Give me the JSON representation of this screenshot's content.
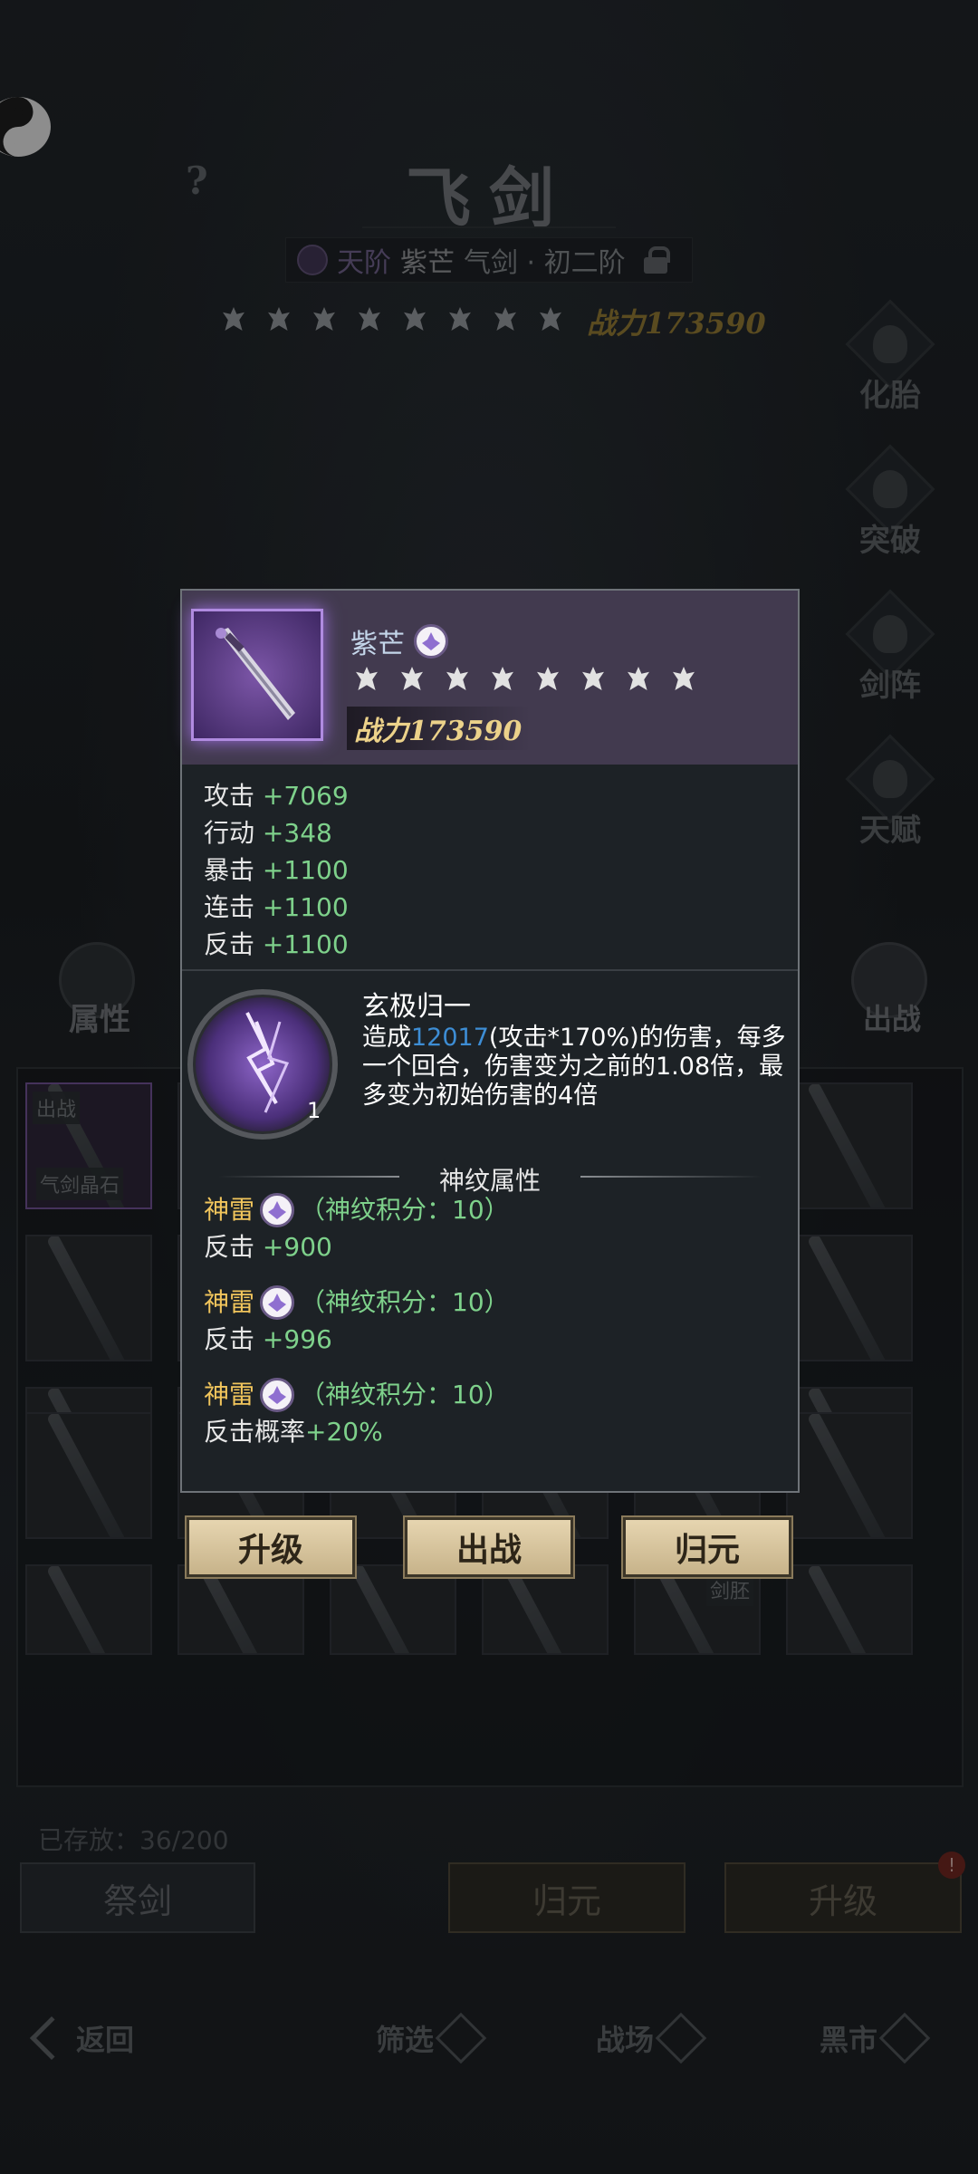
{
  "header": {
    "title": "飞剑",
    "help": "?",
    "grade": "天阶",
    "sword_name": "紫芒",
    "sword_type": "气剑 · 初二阶",
    "power": "战力173590",
    "star_count": 8
  },
  "side_menu": {
    "items": [
      {
        "label": "化胎"
      },
      {
        "label": "突破"
      },
      {
        "label": "剑阵"
      },
      {
        "label": "天赋"
      }
    ],
    "attr_label": "属性",
    "battle_label": "出战"
  },
  "grid": {
    "selected_tag": "气剑晶石",
    "corner_tag": "出战",
    "lower_tag": "剑胚"
  },
  "storage": {
    "text": "已存放：36/200"
  },
  "bottom_buttons": {
    "sacrifice": "祭剑",
    "return_origin": "归元",
    "upgrade": "升级",
    "upgrade_badge": "!"
  },
  "nav": {
    "back": "返回",
    "filter": "筛选",
    "battlefield": "战场",
    "black_market": "黑市"
  },
  "popup": {
    "name": "紫芒",
    "power": "战力173590",
    "stats": [
      {
        "label": "攻击",
        "value": "+7069"
      },
      {
        "label": "行动",
        "value": "+348"
      },
      {
        "label": "暴击",
        "value": "+1100"
      },
      {
        "label": "连击",
        "value": "+1100"
      },
      {
        "label": "反击",
        "value": "+1100"
      }
    ],
    "skill": {
      "name": "玄极归一",
      "level": "1",
      "desc_prefix": "造成",
      "desc_number": "12017",
      "desc_suffix": "(攻击*170%)的伤害，每多一个回合，伤害变为之前的1.08倍，最多变为初始伤害的4倍"
    },
    "rune_title": "神纹属性",
    "runes": [
      {
        "name": "神雷",
        "score": "（神纹积分：10）",
        "stat_label": "反击",
        "stat_value": "+900"
      },
      {
        "name": "神雷",
        "score": "（神纹积分：10）",
        "stat_label": "反击",
        "stat_value": "+996"
      },
      {
        "name": "神雷",
        "score": "（神纹积分：10）",
        "stat_label": "反击概率",
        "stat_value": "+20%"
      }
    ],
    "buttons": {
      "upgrade": "升级",
      "battle": "出战",
      "return_origin": "归元"
    }
  },
  "colors": {
    "accent_purple": "#b08be0",
    "stat_green": "#7ed18b",
    "rune_gold": "#f1c55c",
    "number_blue": "#3d8dd4",
    "power_gold": "#ecd28a"
  }
}
